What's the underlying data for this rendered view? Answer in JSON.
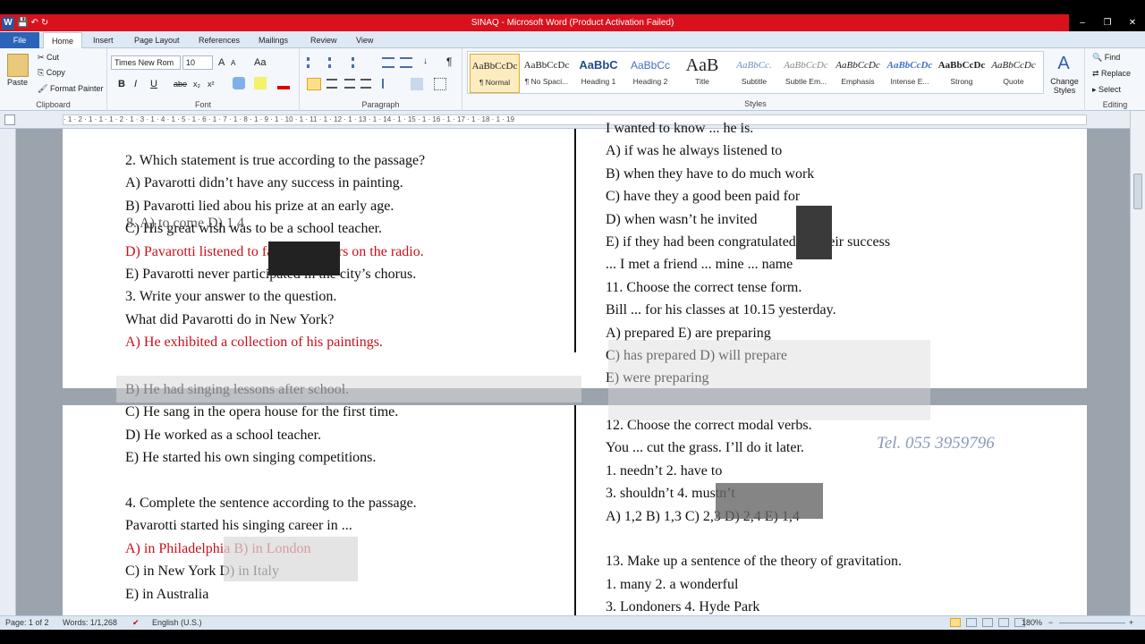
{
  "window": {
    "title": "SINAQ - Microsoft Word (Product Activation Failed)"
  },
  "quick_access": {
    "logo": "W",
    "save": "💾",
    "undo": "↶",
    "redo": "↻"
  },
  "window_controls": {
    "min": "–",
    "max": "❐",
    "close": "✕"
  },
  "tabs": [
    "File",
    "Home",
    "Insert",
    "Page Layout",
    "References",
    "Mailings",
    "Review",
    "View"
  ],
  "clipboard": {
    "paste": "Paste",
    "cut": "Cut",
    "copy": "Copy",
    "format_painter": "Format Painter",
    "label": "Clipboard"
  },
  "font": {
    "name": "Times New Rom",
    "size": "10",
    "label": "Font",
    "b": "B",
    "i": "I",
    "u": "U",
    "abc": "abe",
    "x2": "x₂",
    "x2s": "x²",
    "aa": "Aa",
    "grow": "A",
    "shrink": "A"
  },
  "paragraph": {
    "label": "Paragraph",
    "pilcrow": "¶"
  },
  "styles": {
    "label": "Styles",
    "items": [
      {
        "preview": "AaBbCcDc",
        "name": "¶ Normal"
      },
      {
        "preview": "AaBbCcDc",
        "name": "¶ No Spaci..."
      },
      {
        "preview": "AaBbC",
        "name": "Heading 1"
      },
      {
        "preview": "AaBbCc",
        "name": "Heading 2"
      },
      {
        "preview": "AaB",
        "name": "Title"
      },
      {
        "preview": "AaBbCc.",
        "name": "Subtitle"
      },
      {
        "preview": "AaBbCcDc",
        "name": "Subtle Em..."
      },
      {
        "preview": "AaBbCcDc",
        "name": "Emphasis"
      },
      {
        "preview": "AaBbCcDc",
        "name": "Intense E..."
      },
      {
        "preview": "AaBbCcDc",
        "name": "Strong"
      },
      {
        "preview": "AaBbCcDc",
        "name": "Quote"
      }
    ],
    "change": "Change Styles"
  },
  "editing": {
    "find": "Find",
    "replace": "Replace",
    "select": "Select",
    "label": "Editing"
  },
  "ruler": {
    "marks": "· 1 · 2 · 1 · 1 · 1 · 2 · 1 · 3 · 1 · 4 · 1 · 5 · 1 · 6 · 1 · 7 · 1 · 8 · 1 · 9 · 1 · 10 · 1 · 11 · 1 · 12 · 1 · 13 · 1 · 14 · 1 · 15 · 1 · 16 · 1 · 17 · 1 · 18 · 1 · 19"
  },
  "page1_left": [
    {
      "t": "2. Which statement is true according to the passage?",
      "red": false
    },
    {
      "t": "A) Pavarotti didn’t have any success in painting.",
      "red": false
    },
    {
      "t": "B) Pavarotti lied abou his prize at an early age.",
      "red": false
    },
    {
      "t": "C) His great wish was to be a school teacher.",
      "red": false
    },
    {
      "t": "D) Pavarotti listened to famous singers on the radio.",
      "red": true
    },
    {
      "t": "E) Pavarotti never participated in the city’s chorus.",
      "red": false
    },
    {
      "t": "3. Write your answer to the question.",
      "red": false
    },
    {
      "t": "What did Pavarotti do in New York?",
      "red": false
    },
    {
      "t": "A) He exhibited a collection of his paintings.",
      "red": true
    }
  ],
  "page1_right": [
    {
      "t": "I wanted to know ... he is.",
      "red": false
    },
    {
      "t": "A) if was he always listened to",
      "red": false
    },
    {
      "t": "B) when they have to do much work",
      "red": false
    },
    {
      "t": "C) have they a good been paid for",
      "red": false
    },
    {
      "t": "D) when wasn’t he invited",
      "red": false
    },
    {
      "t": "E) if they had been congratulated on their success",
      "red": false
    },
    {
      "t": "... I met a friend ... mine ... name",
      "red": false
    },
    {
      "t": "11. Choose the correct tense form.",
      "red": false
    },
    {
      "t": "Bill ... for his classes at 10.15 yesterday.",
      "red": false
    },
    {
      "t": "A) prepared          E) are preparing",
      "red": false
    },
    {
      "t": "C) has prepared          D) will prepare",
      "red": false
    },
    {
      "t": "E) were preparing",
      "red": false
    }
  ],
  "page2_left": [
    {
      "t": "B) He had singing lessons after school.",
      "red": false
    },
    {
      "t": "C) He sang in the opera house for the first time.",
      "red": false
    },
    {
      "t": "D) He worked as a school teacher.",
      "red": false
    },
    {
      "t": "E) He started his own singing competitions.",
      "red": false
    },
    {
      "t": "",
      "red": false
    },
    {
      "t": "4. Complete the sentence according to the passage.",
      "red": false
    },
    {
      "t": "Pavarotti started his singing career in ...",
      "red": false
    },
    {
      "t": "A) in Philadelphia          B) in London",
      "red": true
    },
    {
      "t": "C) in New York          D) in Italy",
      "red": false
    },
    {
      "t": "E) in Australia",
      "red": false
    }
  ],
  "page2_right": [
    {
      "t": "12. Choose the correct modal verbs.",
      "red": false
    },
    {
      "t": "You ... cut the grass. I’ll do it later.",
      "red": false
    },
    {
      "t": "1. needn’t          2. have to",
      "red": false
    },
    {
      "t": "3. shouldn’t          4. mustn’t",
      "red": false
    },
    {
      "t": "A) 1,2    B) 1,3    C) 2,3    D) 2,4    E) 1,4",
      "red": false
    },
    {
      "t": "",
      "red": false
    },
    {
      "t": "13. Make up a sentence of the theory of gravitation.",
      "red": false
    },
    {
      "t": "1. many          2. a wonderful",
      "red": false
    },
    {
      "t": "3. Londoners          4. Hyde Park",
      "red": false
    }
  ],
  "phone": "Tel. 055 3959796",
  "overlay_text": "8. A) to come  D) 1,4",
  "status": {
    "page": "Page: 1 of 2",
    "words": "Words: 1/1,268",
    "lang": "English (U.S.)",
    "zoom": "180%",
    "minus": "−",
    "plus": "+"
  }
}
